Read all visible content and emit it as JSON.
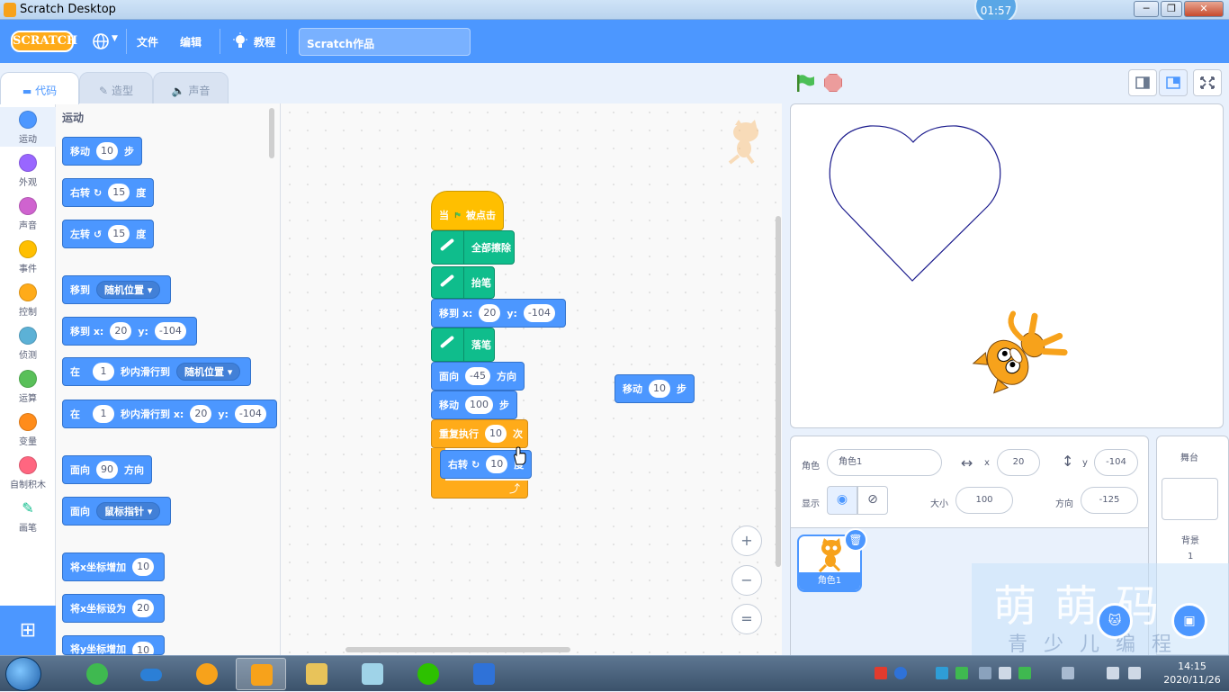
{
  "window": {
    "title": "Scratch Desktop",
    "clock_overlay": "01:57"
  },
  "menubar": {
    "logo": "SCRATCH",
    "items": {
      "file": "文件",
      "edit": "编辑",
      "tutorials": "教程"
    },
    "project_title": "Scratch作品"
  },
  "tabs": {
    "code": "代码",
    "costumes": "造型",
    "sounds": "声音"
  },
  "categories": [
    {
      "label": "运动",
      "color": "#4c97ff"
    },
    {
      "label": "外观",
      "color": "#9966ff"
    },
    {
      "label": "声音",
      "color": "#cf63cf"
    },
    {
      "label": "事件",
      "color": "#ffbf00"
    },
    {
      "label": "控制",
      "color": "#ffab19"
    },
    {
      "label": "侦测",
      "color": "#5cb1d6"
    },
    {
      "label": "运算",
      "color": "#59c059"
    },
    {
      "label": "变量",
      "color": "#ff8c1a"
    },
    {
      "label": "自制积木",
      "color": "#ff6680"
    },
    {
      "label": "画笔",
      "color": "#0fbd8c"
    }
  ],
  "palette": {
    "heading": "运动",
    "move": {
      "a": "移动",
      "v": "10",
      "b": "步"
    },
    "turn_right": {
      "a": "右转",
      "v": "15",
      "b": "度"
    },
    "turn_left": {
      "a": "左转",
      "v": "15",
      "b": "度"
    },
    "goto": {
      "a": "移到",
      "dd": "随机位置"
    },
    "goto_xy": {
      "a": "移到 x:",
      "x": "20",
      "b": "y:",
      "y": "-104"
    },
    "glide": {
      "a": "在",
      "v": "1",
      "b": "秒内滑行到",
      "dd": "随机位置"
    },
    "glide_xy": {
      "a": "在",
      "v": "1",
      "b": "秒内滑行到 x:",
      "x": "20",
      "c": "y:",
      "y": "-104"
    },
    "point_dir": {
      "a": "面向",
      "v": "90",
      "b": "方向"
    },
    "point_towards": {
      "a": "面向",
      "dd": "鼠标指针"
    },
    "change_x": {
      "a": "将x坐标增加",
      "v": "10"
    },
    "set_x": {
      "a": "将x坐标设为",
      "v": "20"
    },
    "change_y": {
      "a": "将y坐标增加",
      "v": "10"
    }
  },
  "script": {
    "hat": {
      "a": "当",
      "b": "被点击"
    },
    "clear": "全部擦除",
    "pen_up": "抬笔",
    "goto_xy": {
      "a": "移到 x:",
      "x": "20",
      "b": "y:",
      "y": "-104"
    },
    "pen_down": "落笔",
    "point_dir": {
      "a": "面向",
      "v": "-45",
      "b": "方向"
    },
    "move": {
      "a": "移动",
      "v": "100",
      "b": "步"
    },
    "repeat": {
      "a": "重复执行",
      "v": "10",
      "b": "次"
    },
    "turn": {
      "a": "右转",
      "v": "10",
      "b": "度"
    },
    "loose_move": {
      "a": "移动",
      "v": "10",
      "b": "步"
    },
    "repeat_arrow": "⤴"
  },
  "zoom": {
    "in": "+",
    "out": "−",
    "reset": "="
  },
  "sprite_info": {
    "sprite_label": "角色",
    "sprite_name": "角色1",
    "x_label": "x",
    "x": "20",
    "y_label": "y",
    "y": "-104",
    "show_label": "显示",
    "size_label": "大小",
    "size": "100",
    "direction_label": "方向",
    "direction": "-125"
  },
  "sprites": [
    {
      "name": "角色1"
    }
  ],
  "stage_panel": {
    "title": "舞台",
    "backdrops_label": "背景",
    "backdrops_count": "1"
  },
  "watermark": {
    "main": "萌萌码",
    "sub": "青少儿编程"
  },
  "taskbar": {
    "time": "14:15",
    "date": "2020/11/26"
  },
  "colors": {
    "motion": "#4c97ff",
    "pen": "#0fbd8c",
    "event": "#ffbf00",
    "control": "#ffab19",
    "menubar": "#4c97ff",
    "heart_stroke": "#1a1a8c"
  }
}
